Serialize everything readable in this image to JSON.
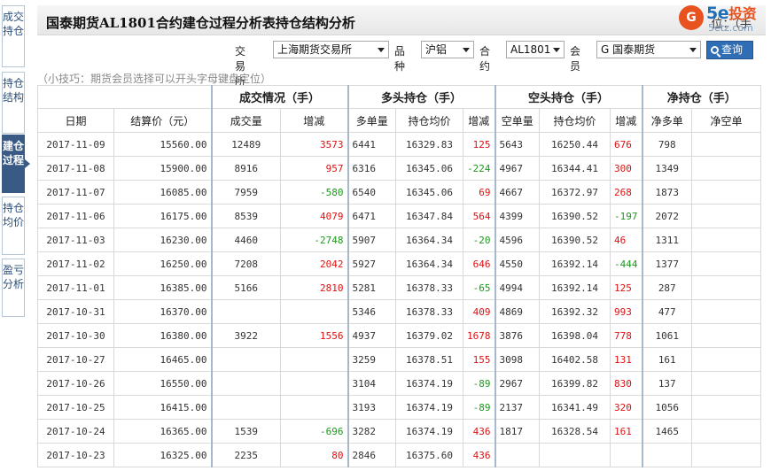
{
  "side_tabs": [
    {
      "label": "成交持仓",
      "active": false
    },
    {
      "label": "持仓结构",
      "active": false
    },
    {
      "label": "建仓过程",
      "active": true
    },
    {
      "label": "持仓均价",
      "active": false
    },
    {
      "label": "盈亏分析",
      "active": false
    }
  ],
  "header": {
    "title": "国泰期货AL1801合约建仓过程分析表持仓结构分析",
    "unit": "位：（手"
  },
  "logo": {
    "circle": "G",
    "main": "5e",
    "main_cn": "投资",
    "sub": "5etz.com"
  },
  "filters": {
    "exchange_label": "交易所",
    "exchange_value": "上海期货交易所",
    "variety_label": "品种",
    "variety_value": "沪铝",
    "contract_label": "合约",
    "contract_value": "AL1801",
    "member_label": "会员",
    "member_value": "G 国泰期货",
    "query_label": "查询"
  },
  "tip": "（小技巧：期货会员选择可以开头字母键盘定位）",
  "table": {
    "groups": [
      "成交情况（手）",
      "多头持仓（手）",
      "空头持仓（手）",
      "净持仓（手）"
    ],
    "columns": [
      "日期",
      "结算价（元）",
      "成交量",
      "增减",
      "多单量",
      "持仓均价",
      "增减",
      "空单量",
      "持仓均价",
      "增减",
      "净多单",
      "净空单"
    ],
    "rows": [
      {
        "date": "2017-11-09",
        "settle": "15560.00",
        "vol": "12489",
        "vol_chg": "3573",
        "long": "6441",
        "long_avg": "16329.83",
        "long_chg": "125",
        "short": "5643",
        "short_avg": "16250.44",
        "short_chg": "676",
        "net_long": "798",
        "net_short": ""
      },
      {
        "date": "2017-11-08",
        "settle": "15900.00",
        "vol": "8916",
        "vol_chg": "957",
        "long": "6316",
        "long_avg": "16345.06",
        "long_chg": "-224",
        "short": "4967",
        "short_avg": "16344.41",
        "short_chg": "300",
        "net_long": "1349",
        "net_short": ""
      },
      {
        "date": "2017-11-07",
        "settle": "16085.00",
        "vol": "7959",
        "vol_chg": "-580",
        "long": "6540",
        "long_avg": "16345.06",
        "long_chg": "69",
        "short": "4667",
        "short_avg": "16372.97",
        "short_chg": "268",
        "net_long": "1873",
        "net_short": ""
      },
      {
        "date": "2017-11-06",
        "settle": "16175.00",
        "vol": "8539",
        "vol_chg": "4079",
        "long": "6471",
        "long_avg": "16347.84",
        "long_chg": "564",
        "short": "4399",
        "short_avg": "16390.52",
        "short_chg": "-197",
        "net_long": "2072",
        "net_short": ""
      },
      {
        "date": "2017-11-03",
        "settle": "16230.00",
        "vol": "4460",
        "vol_chg": "-2748",
        "long": "5907",
        "long_avg": "16364.34",
        "long_chg": "-20",
        "short": "4596",
        "short_avg": "16390.52",
        "short_chg": "46",
        "net_long": "1311",
        "net_short": ""
      },
      {
        "date": "2017-11-02",
        "settle": "16250.00",
        "vol": "7208",
        "vol_chg": "2042",
        "long": "5927",
        "long_avg": "16364.34",
        "long_chg": "646",
        "short": "4550",
        "short_avg": "16392.14",
        "short_chg": "-444",
        "net_long": "1377",
        "net_short": ""
      },
      {
        "date": "2017-11-01",
        "settle": "16385.00",
        "vol": "5166",
        "vol_chg": "2810",
        "long": "5281",
        "long_avg": "16378.33",
        "long_chg": "-65",
        "short": "4994",
        "short_avg": "16392.14",
        "short_chg": "125",
        "net_long": "287",
        "net_short": ""
      },
      {
        "date": "2017-10-31",
        "settle": "16370.00",
        "vol": "",
        "vol_chg": "",
        "long": "5346",
        "long_avg": "16378.33",
        "long_chg": "409",
        "short": "4869",
        "short_avg": "16392.32",
        "short_chg": "993",
        "net_long": "477",
        "net_short": ""
      },
      {
        "date": "2017-10-30",
        "settle": "16380.00",
        "vol": "3922",
        "vol_chg": "1556",
        "long": "4937",
        "long_avg": "16379.02",
        "long_chg": "1678",
        "short": "3876",
        "short_avg": "16398.04",
        "short_chg": "778",
        "net_long": "1061",
        "net_short": ""
      },
      {
        "date": "2017-10-27",
        "settle": "16465.00",
        "vol": "",
        "vol_chg": "",
        "long": "3259",
        "long_avg": "16378.51",
        "long_chg": "155",
        "short": "3098",
        "short_avg": "16402.58",
        "short_chg": "131",
        "net_long": "161",
        "net_short": ""
      },
      {
        "date": "2017-10-26",
        "settle": "16550.00",
        "vol": "",
        "vol_chg": "",
        "long": "3104",
        "long_avg": "16374.19",
        "long_chg": "-89",
        "short": "2967",
        "short_avg": "16399.82",
        "short_chg": "830",
        "net_long": "137",
        "net_short": ""
      },
      {
        "date": "2017-10-25",
        "settle": "16415.00",
        "vol": "",
        "vol_chg": "",
        "long": "3193",
        "long_avg": "16374.19",
        "long_chg": "-89",
        "short": "2137",
        "short_avg": "16341.49",
        "short_chg": "320",
        "net_long": "1056",
        "net_short": ""
      },
      {
        "date": "2017-10-24",
        "settle": "16365.00",
        "vol": "1539",
        "vol_chg": "-696",
        "long": "3282",
        "long_avg": "16374.19",
        "long_chg": "436",
        "short": "1817",
        "short_avg": "16328.54",
        "short_chg": "161",
        "net_long": "1465",
        "net_short": ""
      },
      {
        "date": "2017-10-23",
        "settle": "16325.00",
        "vol": "2235",
        "vol_chg": "80",
        "long": "2846",
        "long_avg": "16375.60",
        "long_chg": "436",
        "short": "",
        "short_avg": "",
        "short_chg": "",
        "net_long": "",
        "net_short": ""
      }
    ]
  },
  "colors": {
    "up": "#e01010",
    "down": "#1a9a1a",
    "accent": "#3a5a86",
    "button": "#2f6db5"
  }
}
